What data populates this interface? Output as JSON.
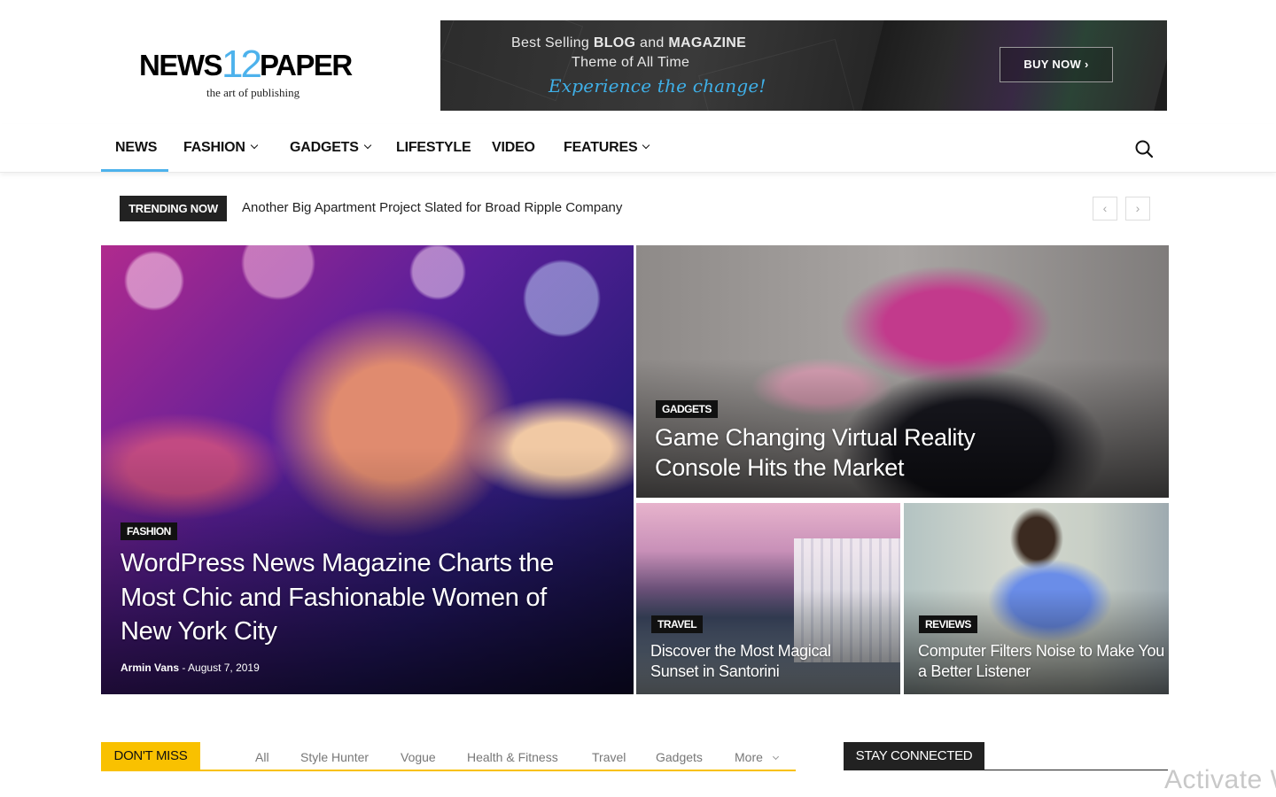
{
  "logo": {
    "part1": "NEWS",
    "num": "12",
    "part2": "PAPER",
    "tagline": "the art of publishing"
  },
  "banner": {
    "line1_pre": "Best Selling ",
    "line1_b1": "BLOG",
    "line1_mid": " and ",
    "line1_b2": "MAGAZINE",
    "line2": "Theme of All Time",
    "line3": "Experience the change!",
    "button": "BUY NOW ›"
  },
  "nav": {
    "items": [
      {
        "label": "NEWS"
      },
      {
        "label": "FASHION"
      },
      {
        "label": "GADGETS"
      },
      {
        "label": "LIFESTYLE"
      },
      {
        "label": "VIDEO"
      },
      {
        "label": "FEATURES"
      }
    ],
    "search_icon": "search-icon"
  },
  "trending": {
    "label": "TRENDING NOW",
    "headline": "Another Big Apartment Project Slated for Broad Ripple Company",
    "prev": "‹",
    "next": "›"
  },
  "featured": {
    "main": {
      "category": "FASHION",
      "title": "WordPress News Magazine Charts the Most Chic and Fashionable Women of New York City",
      "author": "Armin Vans",
      "sep": " - ",
      "date": "August 7, 2019"
    },
    "top_right": {
      "category": "GADGETS",
      "title": "Game Changing Virtual Reality Console Hits the Market"
    },
    "bottom_left": {
      "category": "TRAVEL",
      "title": "Discover the Most Magical Sunset in Santorini"
    },
    "bottom_right": {
      "category": "REVIEWS",
      "title": "Computer Filters Noise to Make You a Better Listener"
    }
  },
  "dont_miss": {
    "label": "DON'T MISS",
    "tabs": [
      "All",
      "Style Hunter",
      "Vogue",
      "Health & Fitness",
      "Travel",
      "Gadgets",
      "More"
    ]
  },
  "stay_connected": {
    "label": "STAY CONNECTED"
  },
  "watermark": "Activate W",
  "colors": {
    "accent": "#4db2ec",
    "dont_miss": "#f9c100",
    "dark": "#222222"
  }
}
